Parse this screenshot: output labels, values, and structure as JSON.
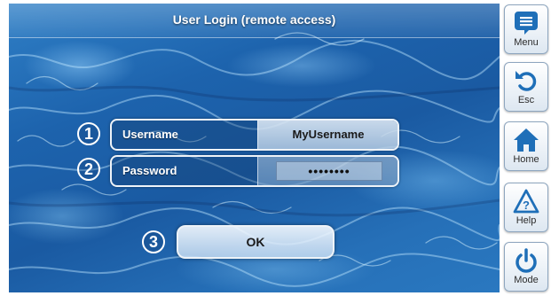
{
  "header": {
    "title": "User Login (remote access)"
  },
  "form": {
    "username": {
      "step": "1",
      "label": "Username",
      "value": "MyUsername"
    },
    "password": {
      "step": "2",
      "label": "Password",
      "masked_value": "••••••••"
    },
    "submit": {
      "step": "3",
      "label": "OK"
    }
  },
  "sidebar": {
    "items": [
      {
        "label": "Menu",
        "icon": "menu-icon"
      },
      {
        "label": "Esc",
        "icon": "undo-icon"
      },
      {
        "label": "Home",
        "icon": "home-icon"
      },
      {
        "label": "Help",
        "icon": "help-warning-icon"
      },
      {
        "label": "Mode",
        "icon": "power-icon"
      }
    ]
  },
  "colors": {
    "water": "#1d63ad",
    "accent": "#1f6fb8",
    "text_light": "#ffffff",
    "text_dark": "#1a1a1a"
  }
}
